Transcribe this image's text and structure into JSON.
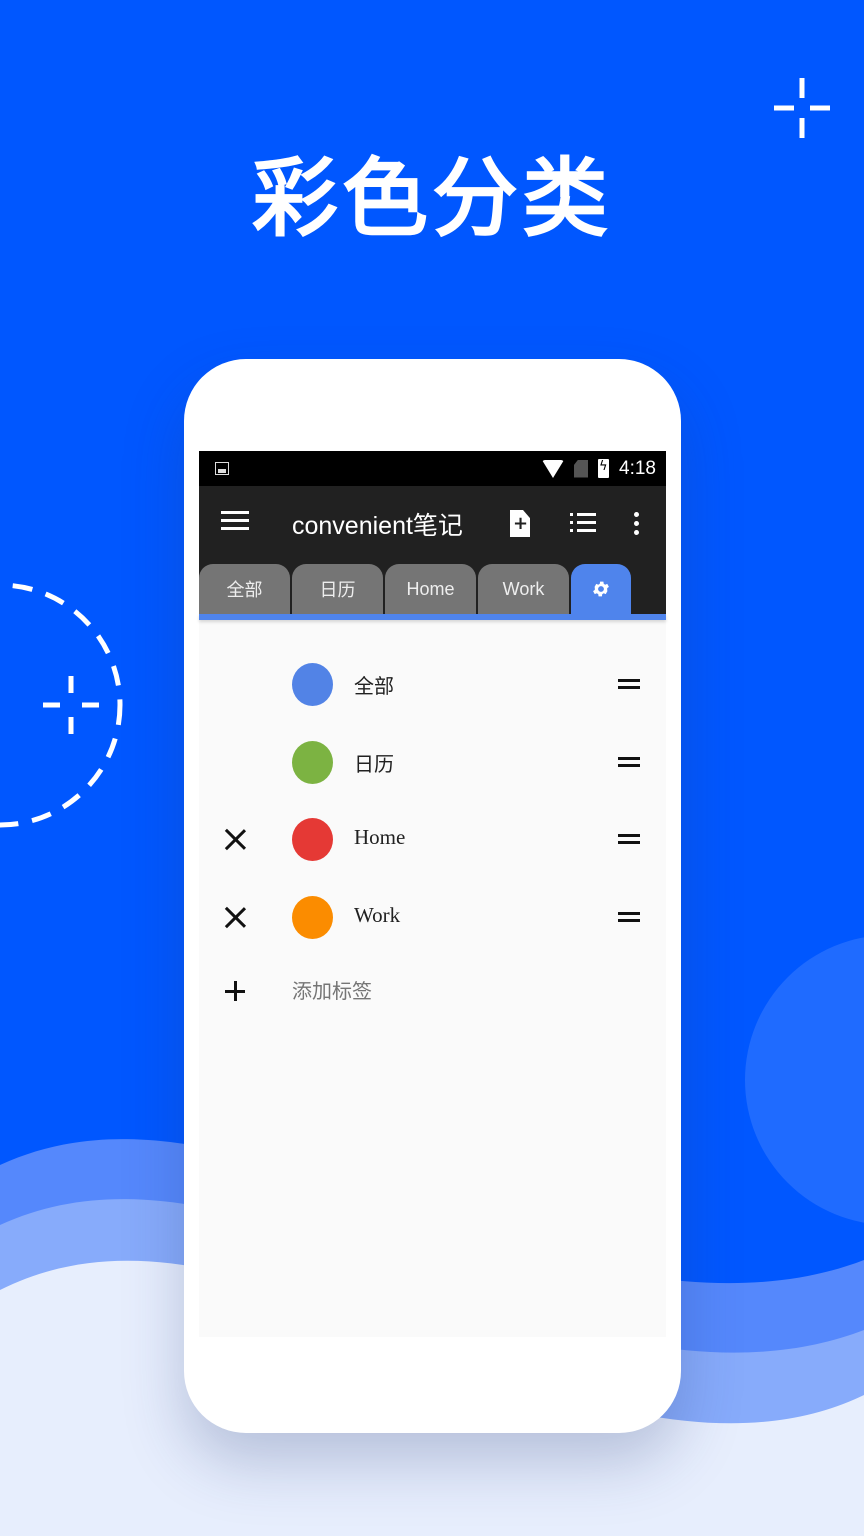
{
  "headline": "彩色分类",
  "colors": {
    "background": "#0057ff",
    "accent": "#4f84ec",
    "toolbar": "#212121",
    "tab_inactive": "#757575"
  },
  "statusbar": {
    "time": "4:18",
    "icons": [
      "image-icon",
      "wifi-icon",
      "no-sim-icon",
      "battery-charging-icon"
    ]
  },
  "appbar": {
    "title": "convenient笔记",
    "actions": [
      "menu-icon",
      "add-note-icon",
      "list-view-icon",
      "more-vert-icon"
    ]
  },
  "tabs": [
    {
      "label": "全部",
      "active": false
    },
    {
      "label": "日历",
      "active": false
    },
    {
      "label": "Home",
      "active": false
    },
    {
      "label": "Work",
      "active": false
    },
    {
      "label": "",
      "icon": "settings-gear-icon",
      "active": true
    }
  ],
  "categories": [
    {
      "label": "全部",
      "color": "#5283e6",
      "deletable": false
    },
    {
      "label": "日历",
      "color": "#7cb342",
      "deletable": false
    },
    {
      "label": "Home",
      "color": "#e53935",
      "deletable": true
    },
    {
      "label": "Work",
      "color": "#fb8c00",
      "deletable": true
    }
  ],
  "add_label": "添加标签"
}
